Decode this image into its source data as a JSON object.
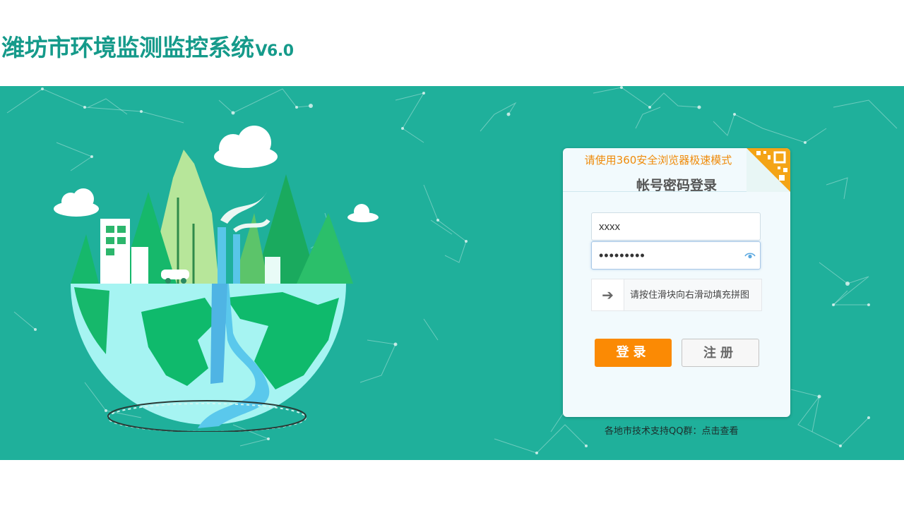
{
  "header": {
    "title": "潍坊市环境监测监控系统",
    "version": "V6.0"
  },
  "login_card": {
    "browser_notice": "请使用360安全浏览器极速模式",
    "title": "帐号密码登录",
    "username_value": "xxxx",
    "password_value": "•••••••••",
    "slider_hint": "请按住滑块向右滑动填充拼图",
    "login_label": "登录",
    "register_label": "注册"
  },
  "footer": {
    "support_text": "各地市技术支持QQ群：",
    "support_link": "点击查看"
  },
  "colors": {
    "brand_teal": "#159a8a",
    "banner_bg": "#1fb09b",
    "notice_orange": "#ef8b0a",
    "login_orange": "#fb8a04"
  },
  "icons": [
    "qr-code-icon",
    "eye-icon",
    "arrow-right-icon"
  ]
}
